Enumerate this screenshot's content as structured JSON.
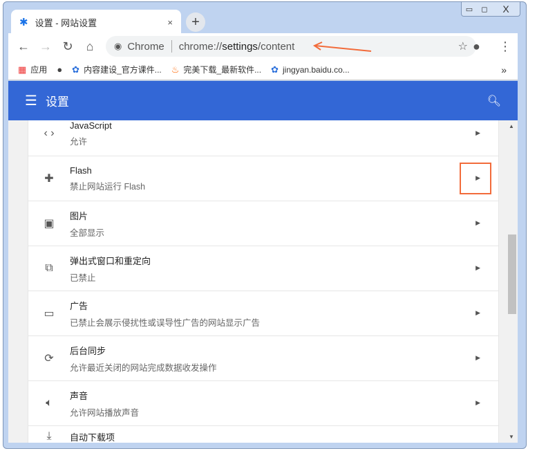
{
  "tab": {
    "title": "设置 - 网站设置",
    "close": "×",
    "new_tab": "+"
  },
  "window": {
    "minimize": "▭",
    "maximize": "◻",
    "close": "X"
  },
  "omnibox": {
    "origin": "Chrome",
    "url_prefix": "chrome://",
    "url_bold": "settings",
    "url_suffix": "/content"
  },
  "bookmarks": [
    {
      "label": "应用",
      "icon": "apps-icon"
    },
    {
      "label": "",
      "icon": "globe-icon"
    },
    {
      "label": "内容建设_官方课件...",
      "icon": "baidu-paw-icon"
    },
    {
      "label": "完美下载_最新软件...",
      "icon": "flame-icon"
    },
    {
      "label": "jingyan.baidu.co...",
      "icon": "baidu-paw-icon"
    }
  ],
  "bookmarks_more": "»",
  "header": {
    "title": "设置"
  },
  "rows": [
    {
      "title": "JavaScript",
      "sub": "允许",
      "icon": "code-icon"
    },
    {
      "title": "Flash",
      "sub": "禁止网站运行 Flash",
      "icon": "puzzle-icon"
    },
    {
      "title": "图片",
      "sub": "全部显示",
      "icon": "image-icon"
    },
    {
      "title": "弹出式窗口和重定向",
      "sub": "已禁止",
      "icon": "open-in-new-icon"
    },
    {
      "title": "广告",
      "sub": "已禁止会展示侵扰性或误导性广告的网站显示广告",
      "icon": "window-icon"
    },
    {
      "title": "后台同步",
      "sub": "允许最近关闭的网站完成数据收发操作",
      "icon": "sync-icon"
    },
    {
      "title": "声音",
      "sub": "允许网站播放声音",
      "icon": "volume-icon"
    },
    {
      "title": "自动下载项",
      "sub": "",
      "icon": "download-icon"
    }
  ],
  "colors": {
    "header": "#3367d6",
    "highlight": "#f26b3a"
  }
}
